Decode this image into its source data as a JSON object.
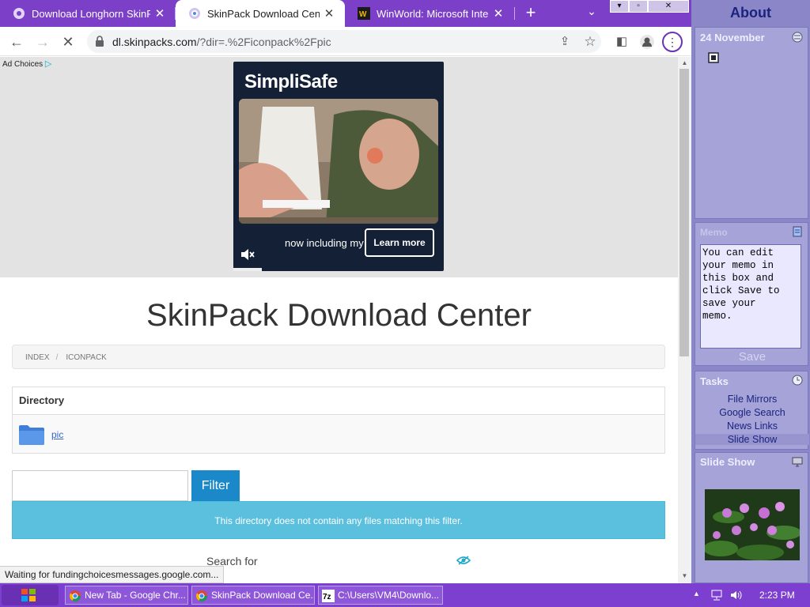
{
  "browser": {
    "tabs": [
      {
        "title": "Download Longhorn SkinPack",
        "active": false
      },
      {
        "title": "SkinPack Download Center",
        "active": true
      },
      {
        "title": "WinWorld: Microsoft Internet",
        "active": false
      }
    ],
    "url_host": "dl.skinpacks.com",
    "url_rest": "/?dir=.%2Ficonpack%2Fpic",
    "status_text": "Waiting for fundingchoicesmessages.google.com..."
  },
  "ad": {
    "choices_label": "Ad Choices",
    "brand": "SimpliSafe",
    "tagline": "now including my c",
    "cta": "Learn more"
  },
  "page": {
    "title": "SkinPack Download Center",
    "breadcrumb": [
      "INDEX",
      "ICONPACK"
    ],
    "directory_header": "Directory",
    "folder_name": "pic",
    "filter_button": "Filter",
    "filter_value": "",
    "alert_text": "This directory does not contain any files matching this filter.",
    "search_label": "Search for"
  },
  "sidebar": {
    "about": "About",
    "date": "24 November",
    "memo_title": "Memo",
    "memo_text": "You can edit your memo in this box and click Save to save your memo.",
    "save_label": "Save",
    "tasks_title": "Tasks",
    "tasks": [
      "File Mirrors",
      "Google Search",
      "News Links",
      "Slide Show"
    ],
    "slideshow_title": "Slide Show"
  },
  "taskbar": {
    "items": [
      {
        "label": "New Tab - Google Chr..."
      },
      {
        "label": "SkinPack Download Ce..."
      },
      {
        "label": "C:\\Users\\VM4\\Downlo..."
      }
    ],
    "clock": "2:23 PM"
  },
  "colors": {
    "tabstrip": "#7b3fc8",
    "filter_button": "#1a88c9",
    "alert_bg": "#5bc0de",
    "sidebar": "#8a86c8",
    "taskbar": "#7c3fd0"
  }
}
